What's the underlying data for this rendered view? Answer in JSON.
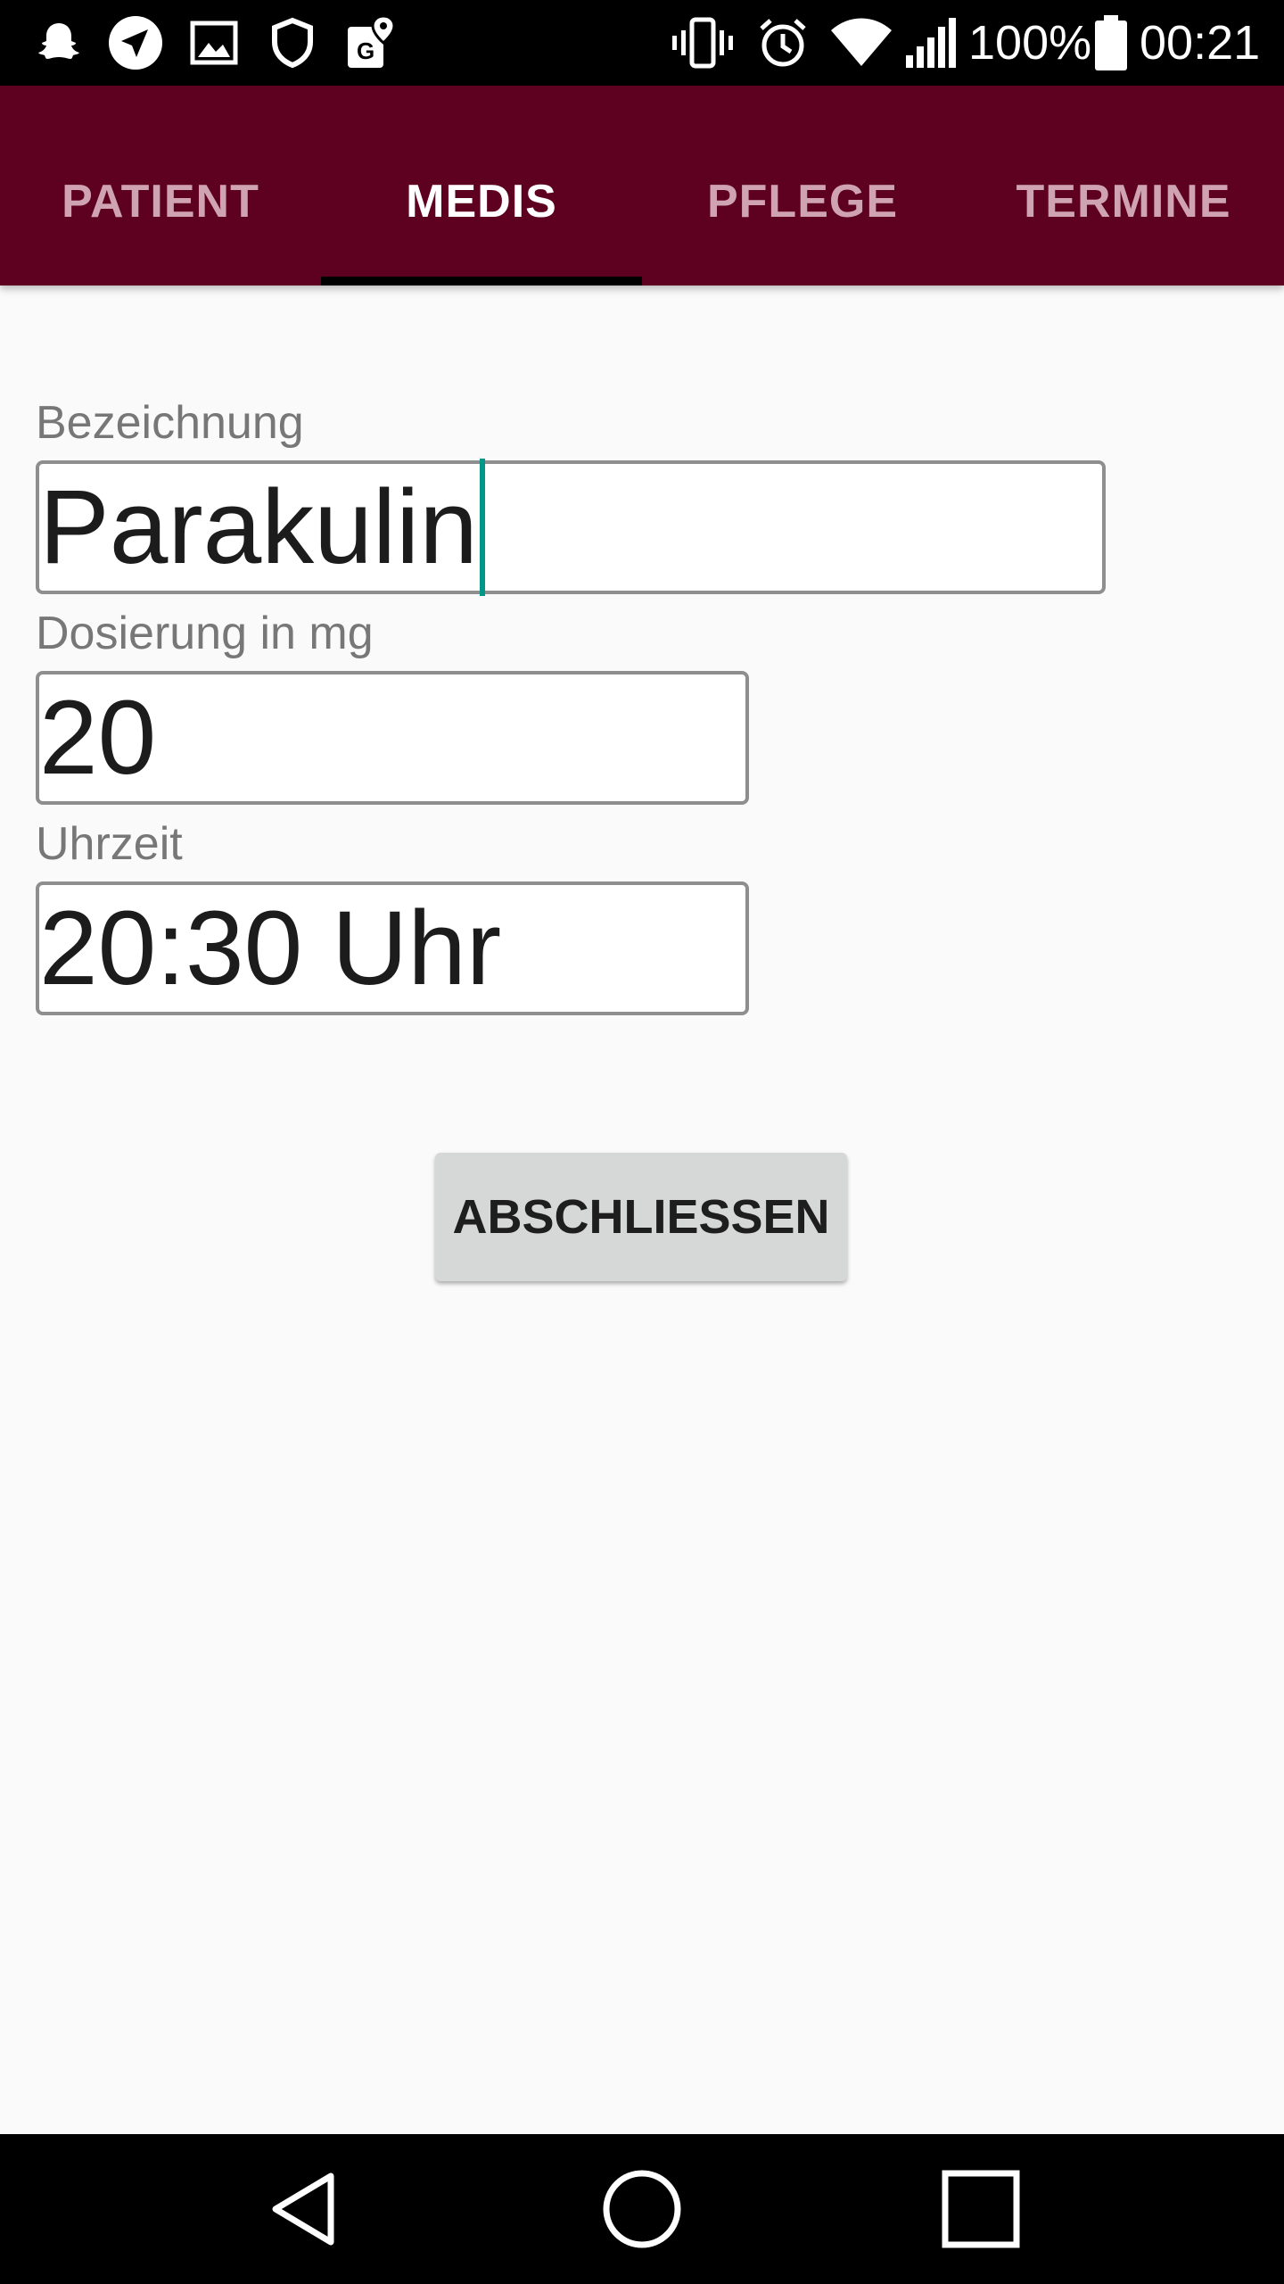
{
  "status_bar": {
    "left_icons": [
      "snapchat-icon",
      "telegram-icon",
      "gallery-icon",
      "shield-icon",
      "maps-icon"
    ],
    "right_icons": [
      "vibrate-icon",
      "alarm-icon",
      "wifi-icon",
      "signal-icon",
      "battery-icon"
    ],
    "battery": "100%",
    "time": "00:21"
  },
  "tabs": [
    {
      "label": "PATIENT",
      "active": false
    },
    {
      "label": "MEDIS",
      "active": true
    },
    {
      "label": "PFLEGE",
      "active": false
    },
    {
      "label": "TERMINE",
      "active": false
    }
  ],
  "form": {
    "name_label": "Bezeichnung",
    "name_value": "Parakulin",
    "dose_label": "Dosierung in mg",
    "dose_value": "20",
    "time_label": "Uhrzeit",
    "time_value": "20:30 Uhr",
    "submit_label": "ABSCHLIESSEN"
  },
  "nav_bar": {
    "buttons": [
      "back-icon",
      "home-icon",
      "recents-icon"
    ]
  },
  "colors": {
    "tab_bar": "#5e0020",
    "caret": "#009688",
    "button": "#d6d7d7"
  }
}
